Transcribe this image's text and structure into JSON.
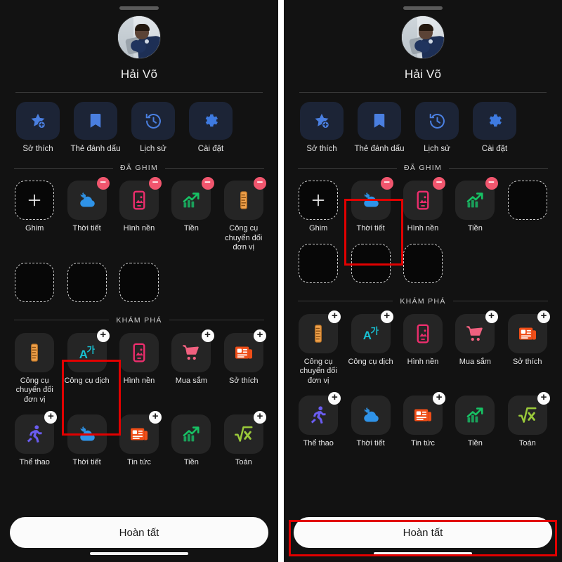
{
  "app": {
    "background": "#121212",
    "accent_red": "#e10000",
    "badge_remove_color": "#f1566e",
    "badge_add_color": "#fcfcfc"
  },
  "profile": {
    "name": "Hải Võ",
    "avatar_icon": "user-photo-avatar",
    "drag_handle_icon": "drag-handle-icon"
  },
  "quick_actions": [
    {
      "label": "Sở thích",
      "icon": "star-plus-icon"
    },
    {
      "label": "Thẻ đánh dấu",
      "icon": "bookmark-icon"
    },
    {
      "label": "Lịch sử",
      "icon": "history-clock-icon"
    },
    {
      "label": "Cài đặt",
      "icon": "gear-icon"
    }
  ],
  "sections": {
    "pinned_title": "ĐÃ GHIM",
    "discover_title": "KHÁM PHÁ"
  },
  "left_panel": {
    "pinned_row1": [
      {
        "label": "Ghim",
        "icon": "plus-add-icon",
        "empty": true,
        "badge": "none"
      },
      {
        "label": "Thời tiết",
        "icon": "weather-cloud-sun-icon",
        "empty": false,
        "badge": "minus"
      },
      {
        "label": "Hình nền",
        "icon": "wallpaper-phone-icon",
        "empty": false,
        "badge": "minus"
      },
      {
        "label": "Tiền",
        "icon": "finance-chart-icon",
        "empty": false,
        "badge": "minus"
      },
      {
        "label": "Công cụ chuyển đổi đơn vị",
        "icon": "unit-converter-ruler-icon",
        "empty": false,
        "badge": "minus"
      }
    ],
    "pinned_row2": [
      {
        "label": "",
        "icon": "empty-slot-icon",
        "empty": true,
        "badge": "none"
      },
      {
        "label": "",
        "icon": "empty-slot-icon",
        "empty": true,
        "badge": "none"
      },
      {
        "label": "",
        "icon": "empty-slot-icon",
        "empty": true,
        "badge": "none"
      }
    ],
    "discover_row1": [
      {
        "label": "Công cụ chuyển đổi đơn vị",
        "icon": "unit-converter-ruler-icon",
        "badge": "none"
      },
      {
        "label": "Công cụ dịch",
        "icon": "translate-icon",
        "badge": "plus"
      },
      {
        "label": "Hình nền",
        "icon": "wallpaper-phone-icon",
        "badge": "none"
      },
      {
        "label": "Mua sắm",
        "icon": "shopping-cart-icon",
        "badge": "plus"
      },
      {
        "label": "Sở thích",
        "icon": "news-hobby-icon",
        "badge": "plus"
      }
    ],
    "discover_row2": [
      {
        "label": "Thể thao",
        "icon": "sports-runner-icon",
        "badge": "plus"
      },
      {
        "label": "Thời tiết",
        "icon": "weather-cloud-sun-icon",
        "badge": "none"
      },
      {
        "label": "Tin tức",
        "icon": "news-icon",
        "badge": "plus"
      },
      {
        "label": "Tiền",
        "icon": "finance-chart-icon",
        "badge": "none"
      },
      {
        "label": "Toán",
        "icon": "math-sqrt-icon",
        "badge": "plus"
      }
    ],
    "done_label": "Hoàn tất",
    "highlight_target": "discover-translate-tool"
  },
  "right_panel": {
    "pinned_row1": [
      {
        "label": "Ghim",
        "icon": "plus-add-icon",
        "empty": true,
        "badge": "none"
      },
      {
        "label": "Thời tiết",
        "icon": "weather-cloud-sun-icon",
        "empty": false,
        "badge": "minus"
      },
      {
        "label": "Hình nền",
        "icon": "wallpaper-phone-icon",
        "empty": false,
        "badge": "minus"
      },
      {
        "label": "Tiền",
        "icon": "finance-chart-icon",
        "empty": false,
        "badge": "minus"
      },
      {
        "label": "",
        "icon": "empty-slot-icon",
        "empty": true,
        "badge": "none"
      }
    ],
    "pinned_row2": [
      {
        "label": "",
        "icon": "empty-slot-icon",
        "empty": true,
        "badge": "none"
      },
      {
        "label": "",
        "icon": "empty-slot-icon",
        "empty": true,
        "badge": "none"
      },
      {
        "label": "",
        "icon": "empty-slot-icon",
        "empty": true,
        "badge": "none"
      }
    ],
    "discover_row1": [
      {
        "label": "Công cụ chuyển đổi đơn vị",
        "icon": "unit-converter-ruler-icon",
        "badge": "plus"
      },
      {
        "label": "Công cụ dịch",
        "icon": "translate-icon",
        "badge": "plus"
      },
      {
        "label": "Hình nền",
        "icon": "wallpaper-phone-icon",
        "badge": "none"
      },
      {
        "label": "Mua sắm",
        "icon": "shopping-cart-icon",
        "badge": "plus"
      },
      {
        "label": "Sở thích",
        "icon": "news-hobby-icon",
        "badge": "plus"
      }
    ],
    "discover_row2": [
      {
        "label": "Thể thao",
        "icon": "sports-runner-icon",
        "badge": "plus"
      },
      {
        "label": "Thời tiết",
        "icon": "weather-cloud-sun-icon",
        "badge": "none"
      },
      {
        "label": "Tin tức",
        "icon": "news-icon",
        "badge": "plus"
      },
      {
        "label": "Tiền",
        "icon": "finance-chart-icon",
        "badge": "none"
      },
      {
        "label": "Toán",
        "icon": "math-sqrt-icon",
        "badge": "plus"
      }
    ],
    "done_label": "Hoàn tất",
    "highlight_targets": [
      "pinned-weather-widget",
      "done-button"
    ]
  },
  "badge_glyphs": {
    "minus": "−",
    "plus": "+"
  }
}
